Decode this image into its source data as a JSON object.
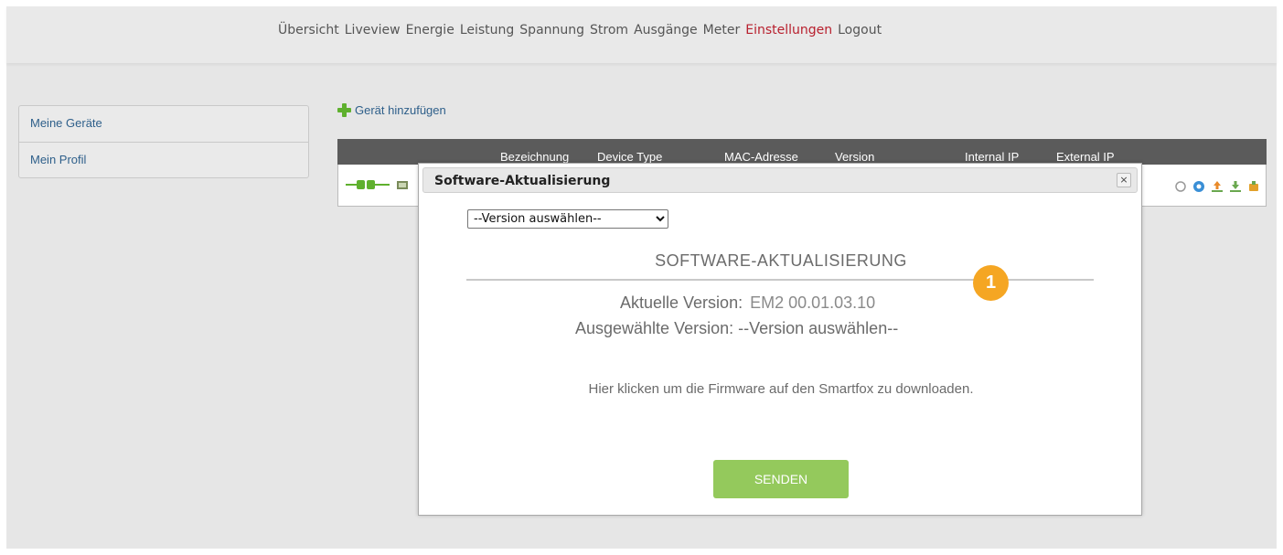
{
  "nav": {
    "items": [
      {
        "label": "Übersicht"
      },
      {
        "label": "Liveview"
      },
      {
        "label": "Energie"
      },
      {
        "label": "Leistung"
      },
      {
        "label": "Spannung"
      },
      {
        "label": "Strom"
      },
      {
        "label": "Ausgänge"
      },
      {
        "label": "Meter"
      },
      {
        "label": "Einstellungen",
        "active": true
      },
      {
        "label": "Logout"
      }
    ],
    "active_color": "#b8202e"
  },
  "sidebar": {
    "items": [
      {
        "label": "Meine Geräte"
      },
      {
        "label": "Mein Profil"
      }
    ]
  },
  "devices": {
    "add_label": "Gerät hinzufügen",
    "columns": [
      "Bezeichnung",
      "Device Type",
      "MAC-Adresse",
      "Version",
      "Internal IP",
      "External IP"
    ]
  },
  "dialog": {
    "title": "Software-Aktualisierung",
    "close_symbol": "×",
    "select": {
      "selected": "--Version auswählen--",
      "options": [
        "--Version auswählen--"
      ]
    },
    "heading": "SOFTWARE-AKTUALISIERUNG",
    "current_label": "Aktuelle Version:",
    "current_value": "EM2 00.01.03.10",
    "selected_line": "Ausgewählte Version: --Version auswählen--",
    "download_text": "Hier klicken um die Firmware auf den Smartfox zu downloaden.",
    "send_label": "SENDEN",
    "send_color": "#94c95c"
  },
  "callout": {
    "label": "1",
    "color": "#f5a623"
  }
}
